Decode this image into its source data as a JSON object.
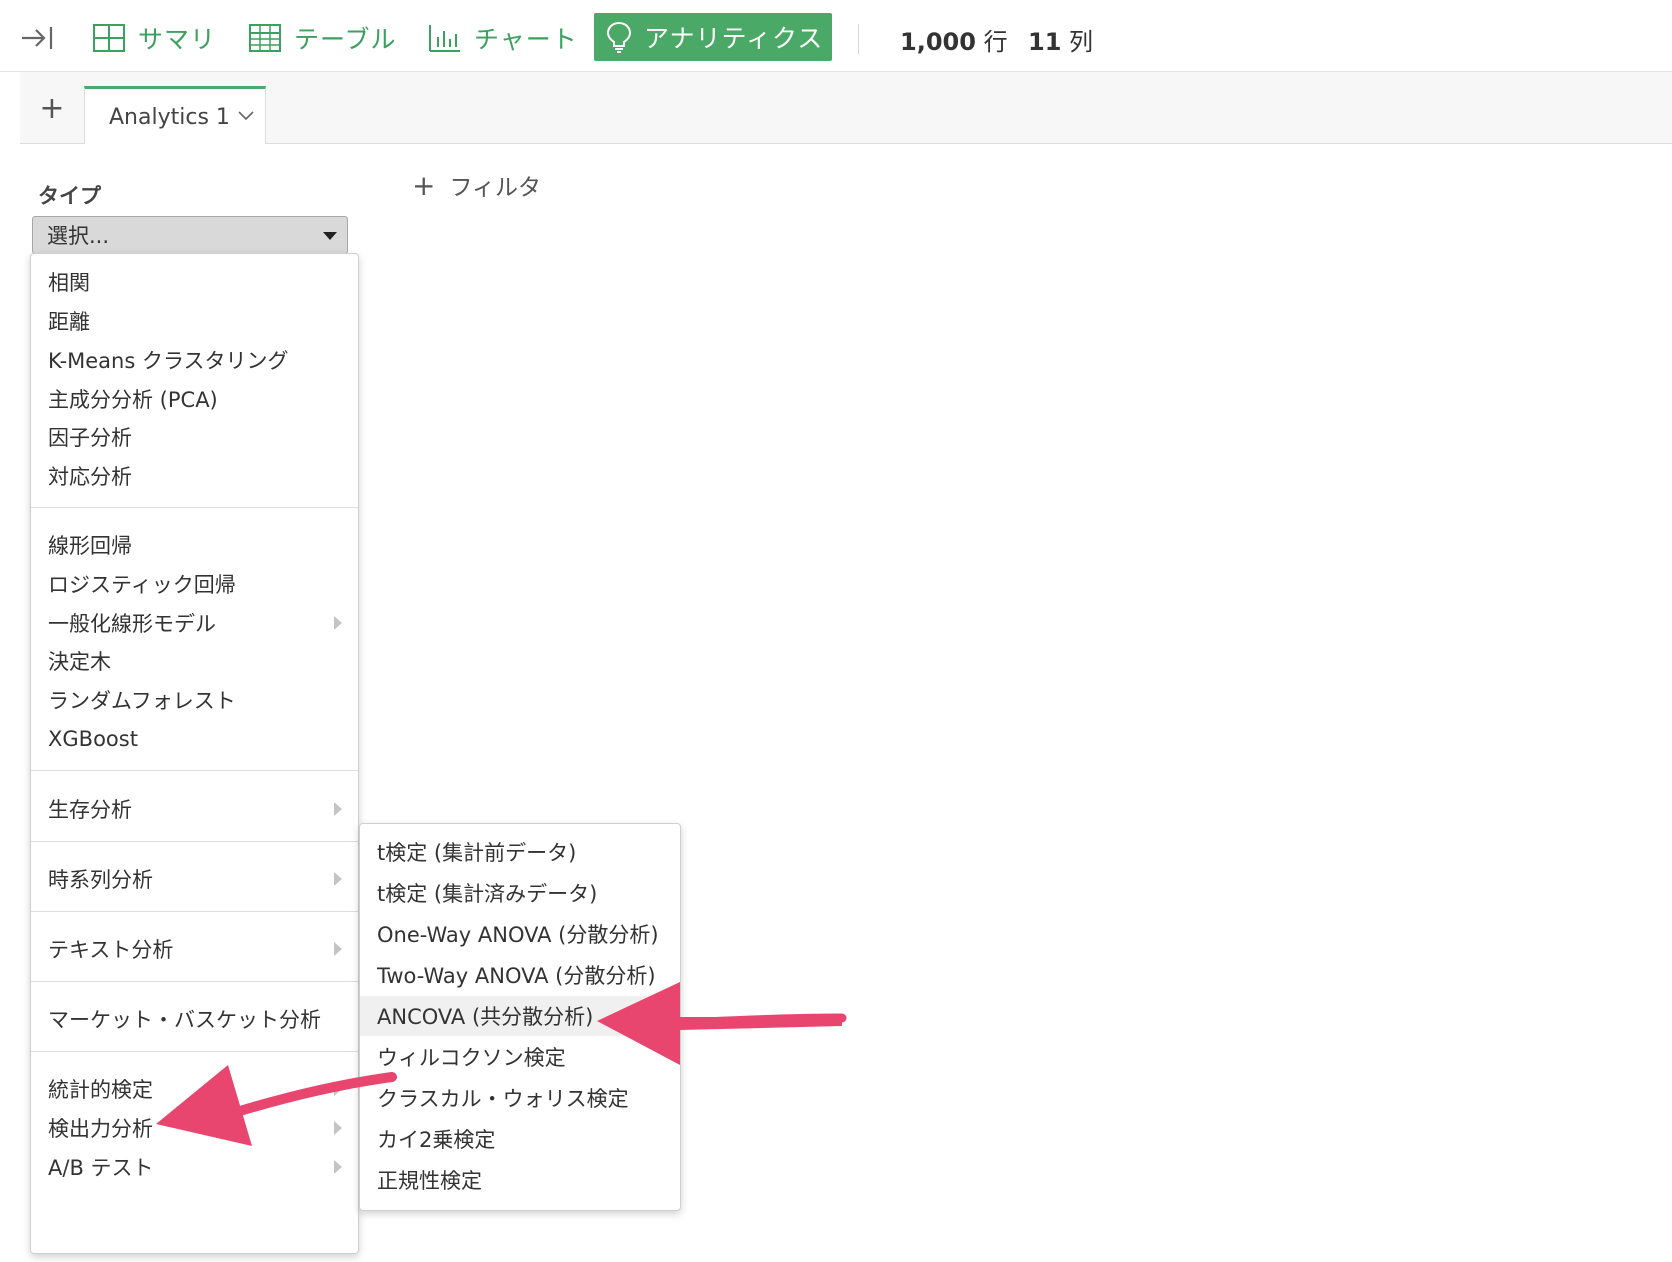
{
  "toolbar": {
    "summary": "サマリ",
    "table": "テーブル",
    "chart": "チャート",
    "analytics": "アナリティクス",
    "rows_count": "1,000",
    "rows_unit": "行",
    "cols_count": "11",
    "cols_unit": "列"
  },
  "tabs": {
    "add": "+",
    "active_label": "Analytics 1"
  },
  "panel": {
    "type_label": "タイプ",
    "select_value": "選択...",
    "filter_label": "フィルタ"
  },
  "menu": {
    "group1": [
      "相関",
      "距離",
      "K-Means クラスタリング",
      "主成分分析 (PCA)",
      "因子分析",
      "対応分析"
    ],
    "group2": [
      "線形回帰",
      "ロジスティック回帰",
      "一般化線形モデル",
      "決定木",
      "ランダムフォレスト",
      "XGBoost"
    ],
    "survival": "生存分析",
    "timeseries": "時系列分析",
    "text": "テキスト分析",
    "basket": "マーケット・バスケット分析",
    "stats": "統計的検定",
    "power": "検出力分析",
    "ab": "A/B テスト"
  },
  "submenu": {
    "items": [
      "t検定 (集計前データ)",
      "t検定 (集計済みデータ)",
      "One-Way ANOVA (分散分析)",
      "Two-Way ANOVA (分散分析)",
      "ANCOVA (共分散分析)",
      "ウィルコクソン検定",
      "クラスカル・ウォリス検定",
      "カイ2乗検定",
      "正規性検定"
    ]
  },
  "colors": {
    "accent": "#4aa966",
    "annotation_arrow": "#e8466f"
  }
}
